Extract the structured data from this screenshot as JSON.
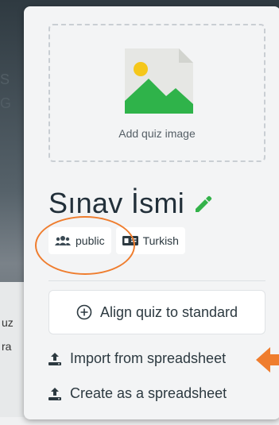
{
  "dropzone": {
    "label": "Add quiz image"
  },
  "quiz": {
    "title": "Sınav İsmi"
  },
  "badges": {
    "visibility": "public",
    "language": "Turkish"
  },
  "actions": {
    "align_label": "Align quiz to standard",
    "import_label": "Import from spreadsheet",
    "create_label": "Create as a spreadsheet"
  },
  "background": {
    "line1": "uz",
    "line2": "ra",
    "line3": "S",
    "line4": "G"
  },
  "colors": {
    "accent_orange": "#ef7d2e",
    "edit_green": "#33b24a",
    "text_dark": "#2c3940"
  },
  "icons": [
    "image-icon",
    "pencil-icon",
    "users-icon",
    "language-icon",
    "plus-circle-icon",
    "upload-icon",
    "arrow-left-icon"
  ]
}
